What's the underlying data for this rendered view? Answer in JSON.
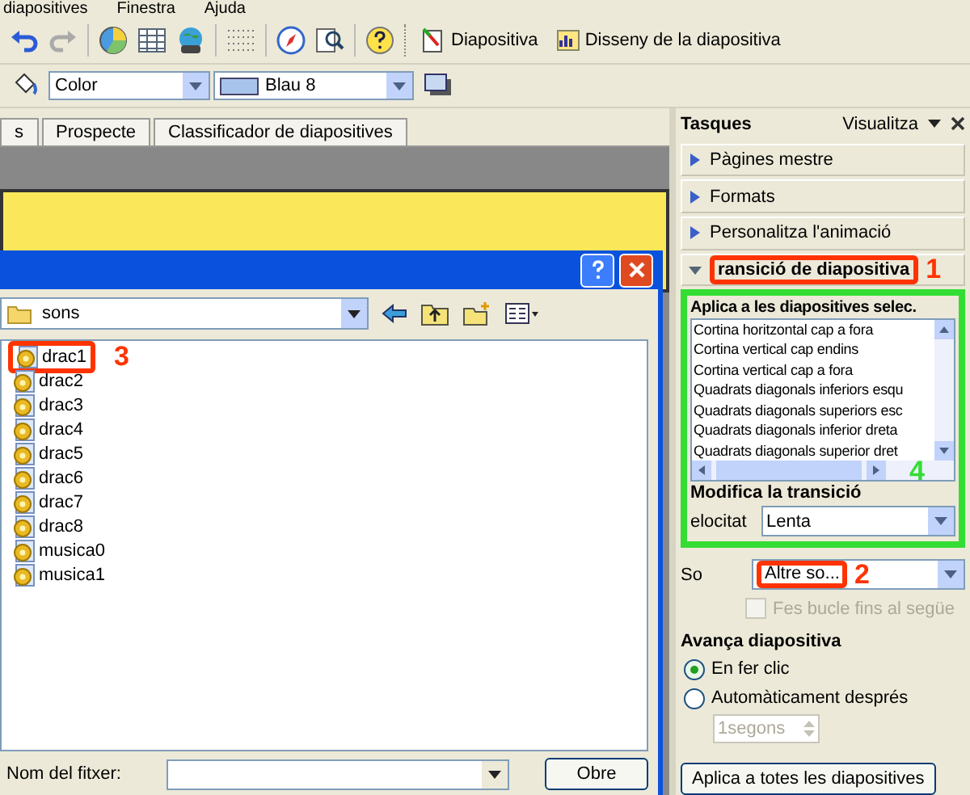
{
  "menu": [
    "diapositives",
    "Finestra",
    "Ajuda"
  ],
  "toolbar": {
    "buttons": [
      {
        "label": "Diapositiva",
        "kind": "slide"
      },
      {
        "label": "Disseny de la diapositiva",
        "kind": "design"
      }
    ]
  },
  "format_bar": {
    "color_mode": "Color",
    "fill": "Blau 8"
  },
  "tabs": [
    {
      "label": "s",
      "selected": false
    },
    {
      "label": "Prospecte",
      "selected": false
    },
    {
      "label": "Classificador de diapositives",
      "selected": false
    }
  ],
  "dialog": {
    "location": "sons",
    "files": [
      {
        "name": "drac1",
        "callout": {
          "label": "3",
          "color": "#ff3300"
        }
      },
      {
        "name": "drac2"
      },
      {
        "name": "drac3"
      },
      {
        "name": "drac4"
      },
      {
        "name": "drac5"
      },
      {
        "name": "drac6"
      },
      {
        "name": "drac7"
      },
      {
        "name": "drac8"
      },
      {
        "name": "musica0"
      },
      {
        "name": "musica1"
      }
    ],
    "filename_label": "Nom del fitxer:",
    "open_button": "Obre"
  },
  "task_pane": {
    "title": "Tasques",
    "view_menu": "Visualitza",
    "sections": [
      {
        "title": "Pàgines mestre",
        "expanded": false
      },
      {
        "title": "Formats",
        "expanded": false
      },
      {
        "title": "Personalitza l'animació",
        "expanded": false
      },
      {
        "title": "ransició de diapositiva",
        "expanded": true,
        "callout": {
          "label": "1",
          "color": "#ff3300"
        }
      }
    ],
    "transition": {
      "title": "Aplica a les diapositives selec.",
      "callout": {
        "label": "4",
        "color": "#33dd33"
      },
      "effects": [
        "Cortina horitzontal cap a fora",
        "Cortina vertical cap endins",
        "Cortina vertical cap a fora",
        "Quadrats diagonals inferiors esqu",
        "Quadrats diagonals superiors esc",
        "Quadrats diagonals inferior dreta",
        "Quadrats diagonals superior dret"
      ],
      "modify_title": "Modifica la transició",
      "speed_label": "elocitat",
      "speed": "Lenta"
    },
    "sound_label": "So",
    "sound": {
      "value": "Altre so...",
      "callout": {
        "label": "2",
        "color": "#ff3300"
      }
    },
    "loop": {
      "label": "Fes bucle fins al següe",
      "checked": false,
      "disabled": true
    },
    "advance_title": "Avança diapositiva",
    "advance_options": [
      {
        "label": "En fer clic",
        "selected": true
      },
      {
        "label": "Automàticament després",
        "selected": false
      }
    ],
    "delay": {
      "value": "1segons",
      "disabled": true
    },
    "apply_all_button": "Aplica a totes les diapositives"
  }
}
